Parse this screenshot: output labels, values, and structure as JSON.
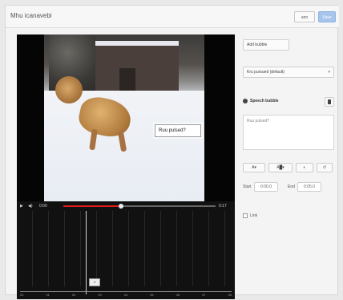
{
  "window": {
    "title": "Mhu icanavebi"
  },
  "header": {
    "cancel_label": "ano",
    "save_label": "Save"
  },
  "video": {
    "caption_text": "Ruu pulsed?",
    "timeline_caption": "3",
    "controls": {
      "time_current": "0:00",
      "time_total": "0:17",
      "progress_fraction": 0.38
    }
  },
  "timeline": {
    "ruler_labels": [
      "00",
      "01",
      "02",
      "03",
      "04",
      "05",
      "06",
      "07",
      "08"
    ]
  },
  "panel": {
    "add_button_label": "Add bubble",
    "select_value": "Kru pursued (default)",
    "section_title": "Speech bubble",
    "textarea_text": "Ruu pulsed?",
    "tools": {
      "t1": "A▾",
      "t2": "A█▾",
      "t3": "◐",
      "t4": "↺"
    },
    "start_label": "Start",
    "start_value": "0:00.0",
    "end_label": "End",
    "end_value": "0:05.0",
    "link_label": "Link"
  }
}
